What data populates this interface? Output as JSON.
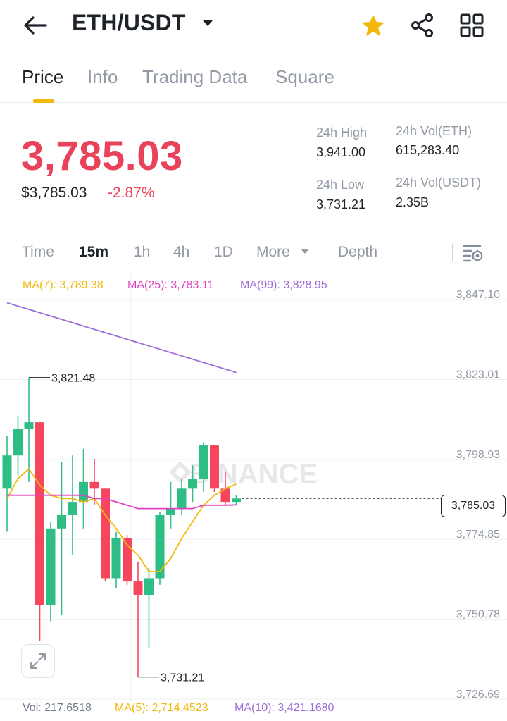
{
  "header": {
    "pair": "ETH/USDT",
    "icons": [
      "back-arrow-icon",
      "caret-down-icon",
      "star-icon",
      "share-icon",
      "grid-icon"
    ]
  },
  "tabs": [
    {
      "label": "Price",
      "active": true
    },
    {
      "label": "Info",
      "active": false
    },
    {
      "label": "Trading Data",
      "active": false
    },
    {
      "label": "Square",
      "active": false
    }
  ],
  "price": {
    "last": "3,785.03",
    "usd": "$3,785.03",
    "change": "-2.87%"
  },
  "stats": {
    "high_label": "24h High",
    "high_value": "3,941.00",
    "low_label": "24h Low",
    "low_value": "3,731.21",
    "vol_eth_label": "24h Vol(ETH)",
    "vol_eth_value": "615,283.40",
    "vol_usdt_label": "24h Vol(USDT)",
    "vol_usdt_value": "2.35B"
  },
  "timeframes": [
    {
      "label": "Time",
      "active": false
    },
    {
      "label": "15m",
      "active": true
    },
    {
      "label": "1h",
      "active": false
    },
    {
      "label": "4h",
      "active": false
    },
    {
      "label": "1D",
      "active": false
    },
    {
      "label": "More",
      "active": false
    },
    {
      "label": "Depth",
      "active": false
    }
  ],
  "ma_legend": {
    "ma7": "MA(7): 3,789.38",
    "ma25": "MA(25): 3,783.11",
    "ma99": "MA(99): 3,828.95"
  },
  "chart": {
    "y_ticks": [
      "3,847.10",
      "3,823.01",
      "3,798.93",
      "3,774.85",
      "3,750.78",
      "3,726.69"
    ],
    "high_marker": "3,821.48",
    "low_marker": "3,731.21",
    "current_price": "3,785.03",
    "watermark": "BINANCE",
    "colors": {
      "up": "#2ebd85",
      "down": "#f6465d",
      "ma7": "#f0b90b",
      "ma25": "#e040c0",
      "ma99": "#9c6fd6"
    }
  },
  "chart_data": {
    "type": "candlestick",
    "interval": "15m",
    "ylim": [
      3726.69,
      3847.1
    ],
    "y_ticks": [
      3847.1,
      3823.01,
      3798.93,
      3774.85,
      3750.78,
      3726.69
    ],
    "candles": [
      {
        "o": 3788,
        "h": 3804,
        "l": 3775,
        "c": 3798
      },
      {
        "o": 3798,
        "h": 3810,
        "l": 3792,
        "c": 3806
      },
      {
        "o": 3806,
        "h": 3821.48,
        "l": 3790,
        "c": 3808
      },
      {
        "o": 3808,
        "h": 3808,
        "l": 3742,
        "c": 3753
      },
      {
        "o": 3753,
        "h": 3778,
        "l": 3748,
        "c": 3776
      },
      {
        "o": 3776,
        "h": 3796,
        "l": 3750,
        "c": 3780
      },
      {
        "o": 3780,
        "h": 3798,
        "l": 3768,
        "c": 3784
      },
      {
        "o": 3784,
        "h": 3800,
        "l": 3776,
        "c": 3790
      },
      {
        "o": 3790,
        "h": 3797,
        "l": 3783,
        "c": 3788
      },
      {
        "o": 3788,
        "h": 3788,
        "l": 3760,
        "c": 3761
      },
      {
        "o": 3761,
        "h": 3775,
        "l": 3758,
        "c": 3773
      },
      {
        "o": 3773,
        "h": 3774,
        "l": 3759,
        "c": 3760
      },
      {
        "o": 3760,
        "h": 3766,
        "l": 3731.21,
        "c": 3756
      },
      {
        "o": 3756,
        "h": 3764,
        "l": 3740,
        "c": 3761
      },
      {
        "o": 3761,
        "h": 3781,
        "l": 3759,
        "c": 3780
      },
      {
        "o": 3780,
        "h": 3790,
        "l": 3776,
        "c": 3782
      },
      {
        "o": 3782,
        "h": 3791,
        "l": 3780,
        "c": 3788
      },
      {
        "o": 3788,
        "h": 3795,
        "l": 3784,
        "c": 3791
      },
      {
        "o": 3791,
        "h": 3802,
        "l": 3787,
        "c": 3801
      },
      {
        "o": 3801,
        "h": 3801,
        "l": 3787,
        "c": 3788
      },
      {
        "o": 3788,
        "h": 3793,
        "l": 3783,
        "c": 3784
      },
      {
        "o": 3784,
        "h": 3786,
        "l": 3783,
        "c": 3785.03
      }
    ],
    "series": [
      {
        "name": "MA(7)",
        "values": [
          3785,
          3791,
          3794,
          3789,
          3786,
          3785,
          3785,
          3784,
          3785,
          3780,
          3776,
          3771,
          3768,
          3763,
          3763,
          3767,
          3773,
          3778,
          3783,
          3786,
          3788,
          3789.38
        ]
      },
      {
        "name": "MA(25)",
        "values": [
          3786,
          3786,
          3786,
          3786,
          3786,
          3786,
          3786,
          3786,
          3785,
          3785,
          3784,
          3783,
          3782,
          3782,
          3782,
          3782,
          3782,
          3782,
          3783,
          3783,
          3783,
          3783.11
        ]
      },
      {
        "name": "MA(99)",
        "values": [
          3844,
          3843,
          3842,
          3841,
          3840,
          3839,
          3838,
          3837,
          3836,
          3835,
          3834,
          3833,
          3832,
          3831,
          3830,
          3829,
          3828,
          3827,
          3826,
          3825,
          3824,
          3823
        ]
      }
    ]
  },
  "volume_legend": {
    "vol": "Vol: 217.6518",
    "ma5": "MA(5): 2,714.4523",
    "ma10": "MA(10): 3,421.1680"
  }
}
